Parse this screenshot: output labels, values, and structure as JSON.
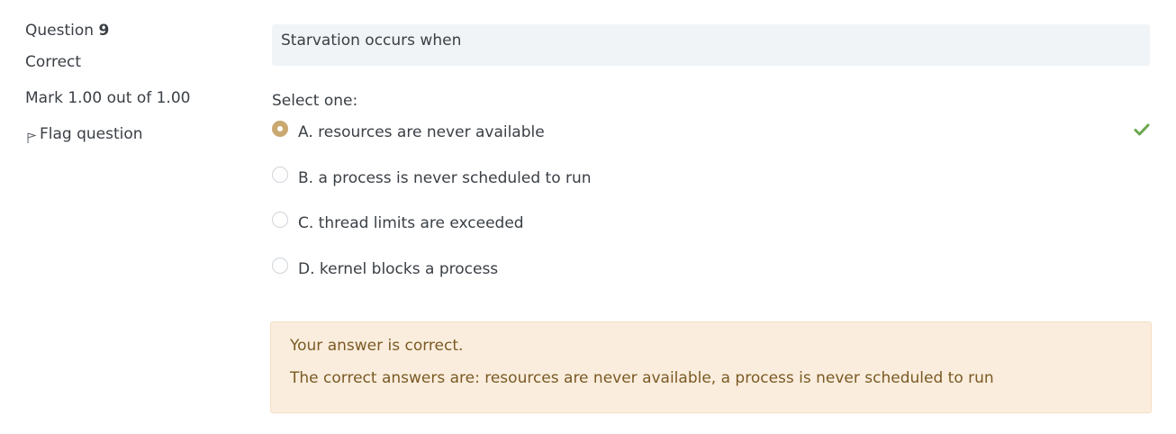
{
  "info": {
    "question_label": "Question",
    "question_number": "9",
    "state": "Correct",
    "grade": "Mark 1.00 out of 1.00",
    "flag_label": "Flag question"
  },
  "question": {
    "text": "Starvation occurs when",
    "prompt": "Select one:",
    "answers": [
      {
        "label": "A. resources are never available",
        "selected": true,
        "marked_correct": true
      },
      {
        "label": "B. a process is never scheduled to run",
        "selected": false
      },
      {
        "label": "C. thread limits are exceeded",
        "selected": false
      },
      {
        "label": "D. kernel blocks a process",
        "selected": false
      }
    ]
  },
  "feedback": {
    "result": "Your answer is correct.",
    "right_answer": "The correct answers are: resources are never available, a process is never scheduled to run"
  },
  "colors": {
    "radio_selected": "#c9a871",
    "check_mark": "#6aa84f",
    "feedback_background": "#faeddd",
    "feedback_text": "#7a5a24",
    "question_background": "#f1f4f7"
  }
}
